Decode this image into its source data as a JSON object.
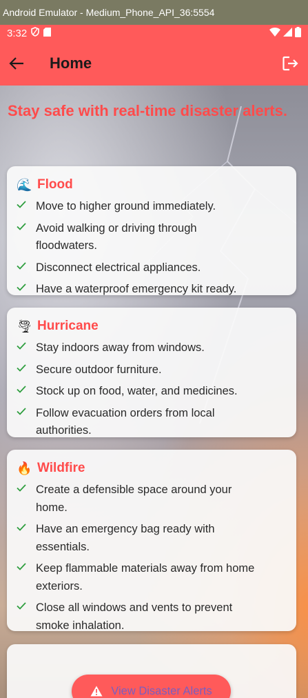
{
  "window": {
    "title": "Android Emulator - Medium_Phone_API_36:5554"
  },
  "status_bar": {
    "time": "3:32"
  },
  "app_bar": {
    "title": "Home"
  },
  "headline": "Stay safe with real-time disaster alerts.",
  "cards": [
    {
      "icon": "wave-icon",
      "emoji": "🌊",
      "title": "Flood",
      "tips": [
        "Move to higher ground immediately.",
        "Avoid walking or driving through floodwaters.",
        "Disconnect electrical appliances.",
        "Have a waterproof emergency kit ready."
      ]
    },
    {
      "icon": "tornado-icon",
      "emoji": "🌪",
      "title": "Hurricane",
      "tips": [
        "Stay indoors away from windows.",
        "Secure outdoor furniture.",
        "Stock up on food, water, and medicines.",
        "Follow evacuation orders from local authorities."
      ]
    },
    {
      "icon": "fire-icon",
      "emoji": "🔥",
      "title": "Wildfire",
      "tips": [
        "Create a defensible space around your home.",
        "Have an emergency bag ready with essentials.",
        "Keep flammable materials away from home exteriors.",
        "Close all windows and vents to prevent smoke inhalation."
      ]
    }
  ],
  "fab": {
    "label": "View Disaster Alerts",
    "icon": "warning-icon"
  },
  "colors": {
    "accent": "#ff5a5a",
    "title_red": "#ff4b4b",
    "check_green": "#2e9e3e",
    "fab_text": "#7a5ec0"
  }
}
